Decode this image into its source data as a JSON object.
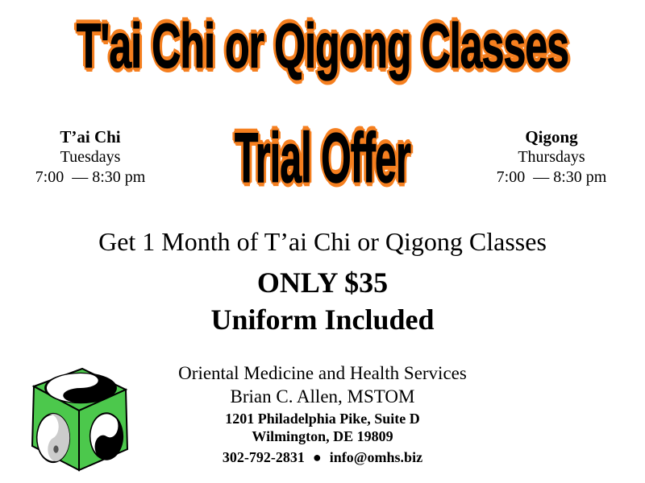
{
  "title": "T'ai Chi or Qigong Classes",
  "subtitle": "Trial Offer",
  "schedule_left": {
    "name": "T’ai Chi",
    "day": "Tuesdays",
    "time": "7:00  — 8:30 pm"
  },
  "schedule_right": {
    "name": "Qigong",
    "day": "Thursdays",
    "time": "7:00  — 8:30 pm"
  },
  "offer": {
    "line": "Get 1 Month of T’ai Chi or Qigong Classes",
    "price": "ONLY $35",
    "uniform": "Uniform Included"
  },
  "contact": {
    "org": "Oriental Medicine and Health Services",
    "person": "Brian C. Allen, MSTOM",
    "address1": "1201 Philadelphia Pike, Suite D",
    "address2": "Wilmington, DE 19809",
    "phone": "302-792-2831",
    "bullet": "●",
    "email": "info@omhs.biz"
  },
  "logo": {
    "icon": "yin-yang-cube-icon"
  },
  "colors": {
    "headline_outline": "#f57f1f",
    "cube_green": "#4cc84c"
  }
}
